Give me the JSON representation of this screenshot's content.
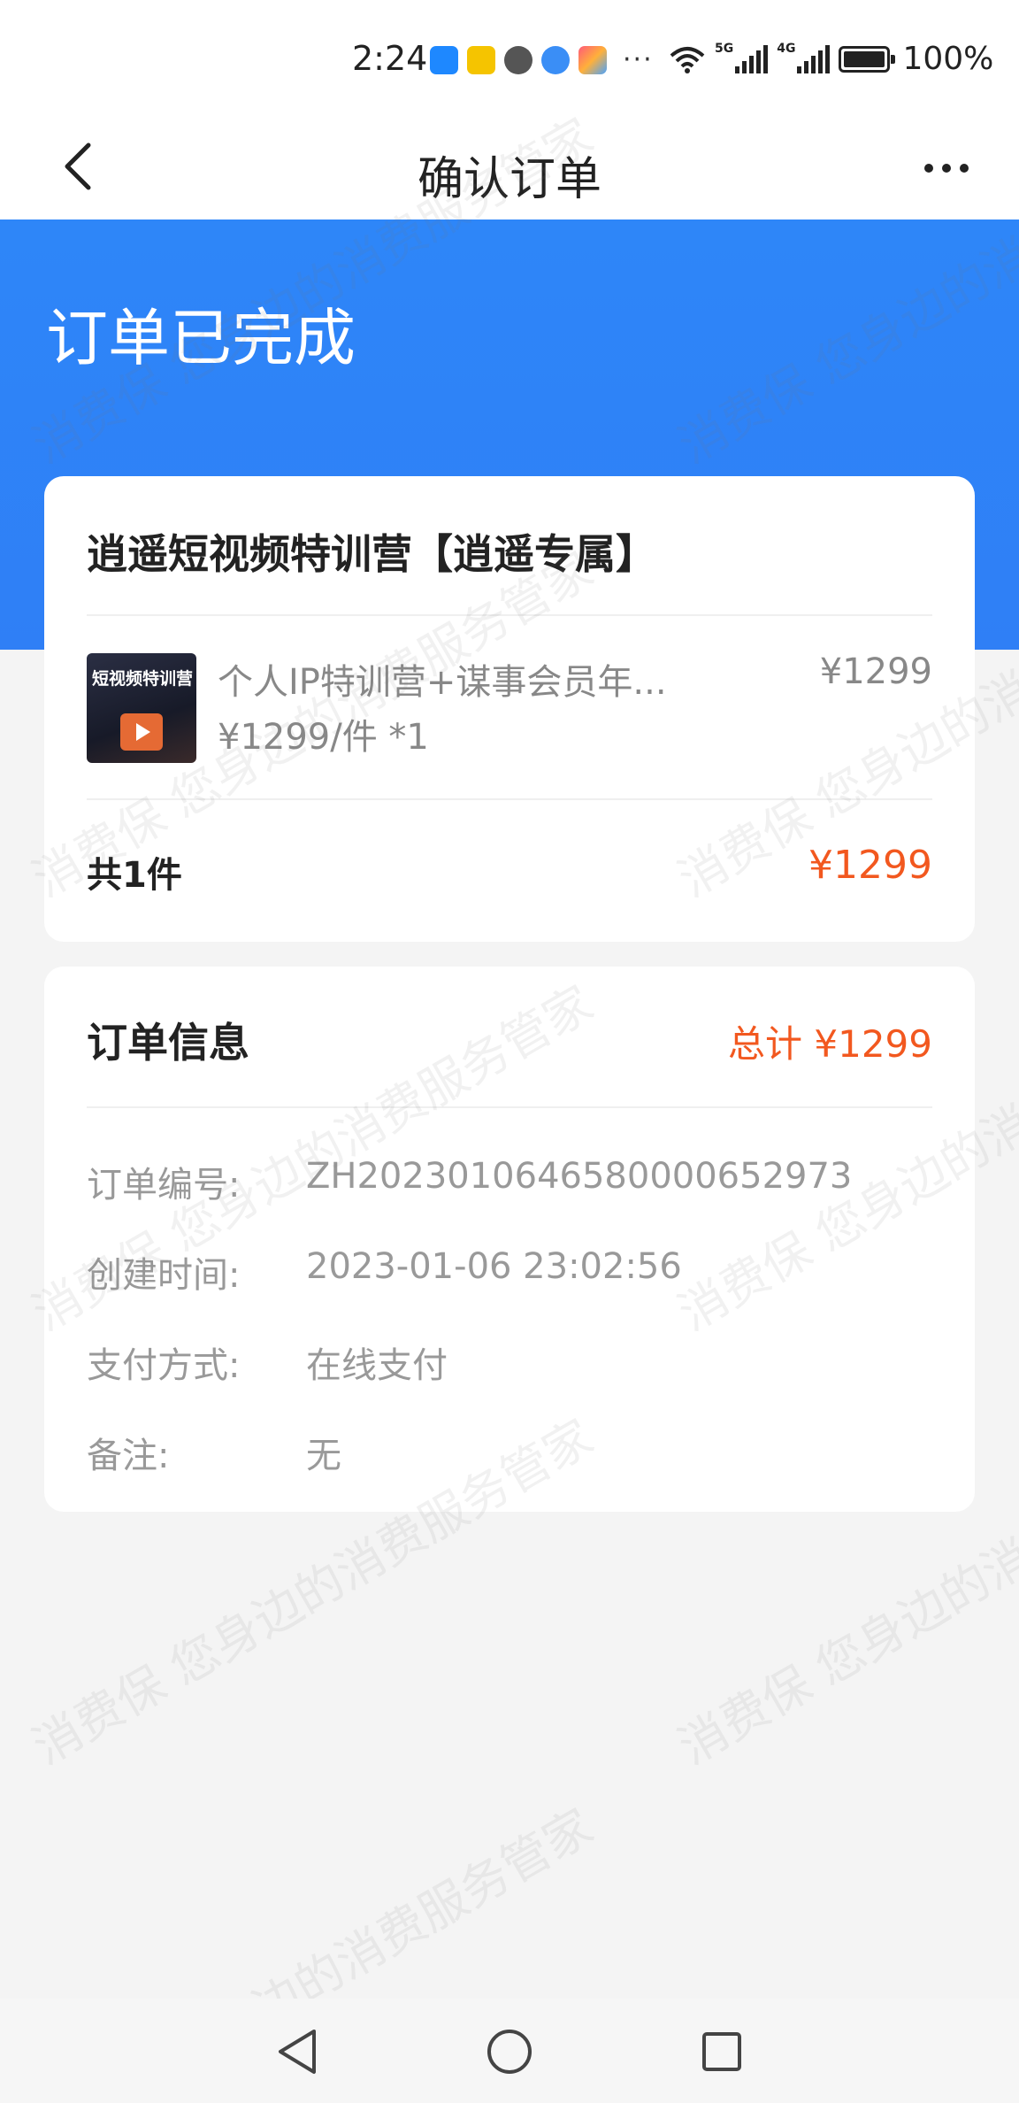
{
  "status_bar": {
    "time": "2:24",
    "more": "···",
    "network_5g": "5G",
    "network_4g": "4G",
    "battery": "100%"
  },
  "nav": {
    "title": "确认订单"
  },
  "order_status": "订单已完成",
  "product_card": {
    "shop_name": "逍遥短视频特训营【逍遥专属】",
    "thumbnail_text": "短视频特训营",
    "item_name": "个人IP特训营+谋事会员年...",
    "item_unit_price": "¥1299/件 *1",
    "item_price": "¥1299",
    "total_count": "共1件",
    "total_price": "¥1299"
  },
  "order_info": {
    "title": "订单信息",
    "total": "总计 ¥1299",
    "rows": [
      {
        "label": "订单编号:",
        "value": "ZH20230106465800006529​73"
      },
      {
        "label": "创建时间:",
        "value": "2023-01-06 23:02:56"
      },
      {
        "label": "支付方式:",
        "value": "在线支付"
      },
      {
        "label": "备注:",
        "value": "无"
      }
    ]
  },
  "watermark_text": "消费保 您身边的消费服务管家",
  "colors": {
    "primary_blue": "#2e86f8",
    "price_orange": "#f2581f",
    "muted_text": "#999999"
  }
}
